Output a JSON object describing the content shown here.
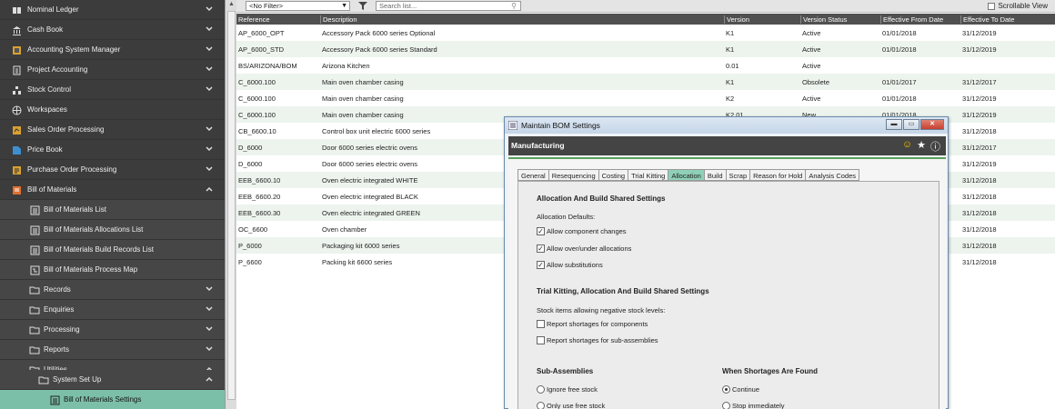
{
  "sidebar": {
    "items": [
      {
        "label": "Nominal Ledger",
        "icon": "ledger-icon"
      },
      {
        "label": "Cash Book",
        "icon": "bank-icon"
      },
      {
        "label": "Accounting System Manager",
        "icon": "system-icon"
      },
      {
        "label": "Project Accounting",
        "icon": "project-icon"
      },
      {
        "label": "Stock Control",
        "icon": "stock-icon"
      },
      {
        "label": "Workspaces",
        "icon": "globe-icon"
      },
      {
        "label": "Sales Order Processing",
        "icon": "sales-icon"
      },
      {
        "label": "Price Book",
        "icon": "price-icon"
      },
      {
        "label": "Purchase Order Processing",
        "icon": "purchase-icon"
      },
      {
        "label": "Bill of Materials",
        "icon": "bom-icon"
      }
    ],
    "sub_items": [
      {
        "label": "Bill of Materials List"
      },
      {
        "label": "Bill of Materials Allocations List"
      },
      {
        "label": "Bill of Materials Build Records List"
      },
      {
        "label": "Bill of Materials Process Map"
      }
    ],
    "folders": [
      {
        "label": "Records"
      },
      {
        "label": "Enquiries"
      },
      {
        "label": "Processing"
      },
      {
        "label": "Reports"
      },
      {
        "label": "Utilities"
      }
    ],
    "system_setup": "System Set Up",
    "active_item": "Bill of Materials Settings"
  },
  "toolbar": {
    "filter_value": "<No Filter>",
    "search_placeholder": "Search list...",
    "scrollable_view": "Scrollable View"
  },
  "grid": {
    "columns": [
      "Reference",
      "Description",
      "Version",
      "Version Status",
      "Effective From Date",
      "Effective To Date"
    ],
    "rows": [
      [
        "AP_6000_OPT",
        "Accessory Pack 6000 series Optional",
        "K1",
        "Active",
        "01/01/2018",
        "31/12/2019"
      ],
      [
        "AP_6000_STD",
        "Accessory Pack 6000 series Standard",
        "K1",
        "Active",
        "01/01/2018",
        "31/12/2019"
      ],
      [
        "BS/ARIZONA/BOM",
        "Arizona Kitchen",
        "0.01",
        "Active",
        "",
        ""
      ],
      [
        "C_6000.100",
        "Main oven chamber casing",
        "K1",
        "Obsolete",
        "01/01/2017",
        "31/12/2017"
      ],
      [
        "C_6000.100",
        "Main oven chamber casing",
        "K2",
        "Active",
        "01/01/2018",
        "31/12/2019"
      ],
      [
        "C_6000.100",
        "Main oven chamber casing",
        "K2.01",
        "New",
        "01/01/2018",
        "31/12/2019"
      ],
      [
        "CB_6600.10",
        "Control box unit electric 6000 series",
        "",
        "",
        "",
        "31/12/2018"
      ],
      [
        "D_6000",
        "Door 6000 series electric ovens",
        "",
        "",
        "",
        "31/12/2017"
      ],
      [
        "D_6000",
        "Door 6000 series electric ovens",
        "",
        "",
        "",
        "31/12/2019"
      ],
      [
        "EEB_6600.10",
        "Oven electric integrated WHITE",
        "",
        "",
        "",
        "31/12/2018"
      ],
      [
        "EEB_6600.20",
        "Oven electric integrated BLACK",
        "",
        "",
        "",
        "31/12/2018"
      ],
      [
        "EEB_6600.30",
        "Oven electric integrated GREEN",
        "",
        "",
        "",
        "31/12/2018"
      ],
      [
        "OC_6600",
        "Oven chamber",
        "",
        "",
        "",
        "31/12/2018"
      ],
      [
        "P_6000",
        "Packaging kit 6000 series",
        "",
        "",
        "",
        "31/12/2018"
      ],
      [
        "P_6600",
        "Packing kit 6600 series",
        "",
        "",
        "",
        "31/12/2018"
      ]
    ]
  },
  "dialog": {
    "title": "Maintain BOM Settings",
    "header": "Manufacturing",
    "tabs": [
      "General",
      "Resequencing",
      "Costing",
      "Trial Kitting",
      "Allocation",
      "Build",
      "Scrap",
      "Reason for Hold",
      "Analysis Codes"
    ],
    "active_tab": "Allocation",
    "section1_title": "Allocation And Build Shared Settings",
    "alloc_defaults_label": "Allocation Defaults:",
    "checks1": [
      {
        "label": "Allow component changes",
        "checked": true
      },
      {
        "label": "Allow over/under allocations",
        "checked": true
      },
      {
        "label": "Allow substitutions",
        "checked": true
      }
    ],
    "section2_title": "Trial Kitting, Allocation And Build Shared Settings",
    "neg_stock_label": "Stock items allowing negative stock levels:",
    "checks2": [
      {
        "label": "Report shortages for components",
        "checked": false
      },
      {
        "label": "Report shortages for sub-assemblies",
        "checked": false
      }
    ],
    "subassemblies_title": "Sub-Assemblies",
    "subassemblies_options": [
      {
        "label": "Ignore free stock",
        "selected": false
      },
      {
        "label": "Only use free stock",
        "selected": false
      }
    ],
    "shortages_title": "When Shortages Are Found",
    "shortages_options": [
      {
        "label": "Continue",
        "selected": true
      },
      {
        "label": "Stop immediately",
        "selected": false
      }
    ]
  }
}
